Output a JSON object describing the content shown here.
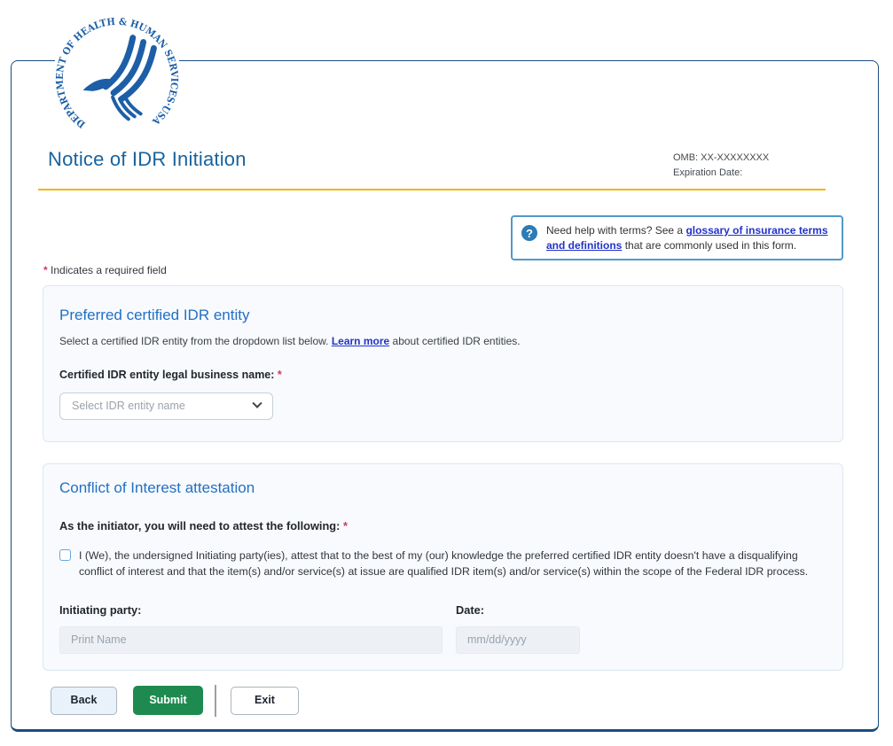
{
  "header": {
    "title": "Notice of IDR Initiation",
    "omb": "OMB: XX-XXXXXXXX",
    "expiration": "Expiration Date:"
  },
  "logo": {
    "ring_text": "DEPARTMENT OF HEALTH & HUMAN SERVICES·USA"
  },
  "help_box": {
    "icon": "question-circle-icon",
    "question_glyph": "?",
    "text_before": "Need help with terms? See a",
    "link_text": "glossary of insurance terms and definitions",
    "text_after": "that are commonly used in this form."
  },
  "required_note": {
    "mark": "*",
    "text": "Indicates a required field"
  },
  "idr_entity_section": {
    "heading": "Preferred certified IDR entity",
    "description_before": "Select a certified IDR entity from the dropdown list below.",
    "learn_more": "Learn more",
    "description_after": "about certified IDR entities.",
    "field_label": "Certified IDR entity legal business name:",
    "required_mark": "*",
    "dropdown_placeholder": "Select IDR entity name",
    "dropdown_value": ""
  },
  "attestation_section": {
    "heading": "Conflict of Interest attestation",
    "intro": "As the initiator, you will need to attest the following:",
    "required_mark": "*",
    "checkbox_checked": false,
    "checkbox_label": "I (We), the undersigned Initiating party(ies), attest that to the best of my (our) knowledge the preferred certified IDR entity doesn't have a disqualifying conflict of interest and that the item(s) and/or service(s) at issue are qualified IDR item(s) and/or service(s) within the scope of the Federal IDR process.",
    "initiating_party": {
      "label": "Initiating party:",
      "placeholder": "Print Name",
      "value": ""
    },
    "date": {
      "label": "Date:",
      "placeholder": "mm/dd/yyyy",
      "value": ""
    }
  },
  "actions": {
    "back": "Back",
    "submit": "Submit",
    "exit": "Exit"
  },
  "colors": {
    "card_border_navy": "#1a4d80",
    "title_blue": "#18639e",
    "section_heading_blue": "#2270c4",
    "accent_gold": "#f2b411",
    "help_border_blue": "#4f9ac9",
    "help_icon_blue": "#2e7bb5",
    "link_blue": "#2233c9",
    "required_red": "#d6375c",
    "submit_green": "#1e8a4f",
    "section_bg": "#f8fafd",
    "input_bg": "#edf1f5",
    "logo_blue": "#1d5fa7"
  }
}
